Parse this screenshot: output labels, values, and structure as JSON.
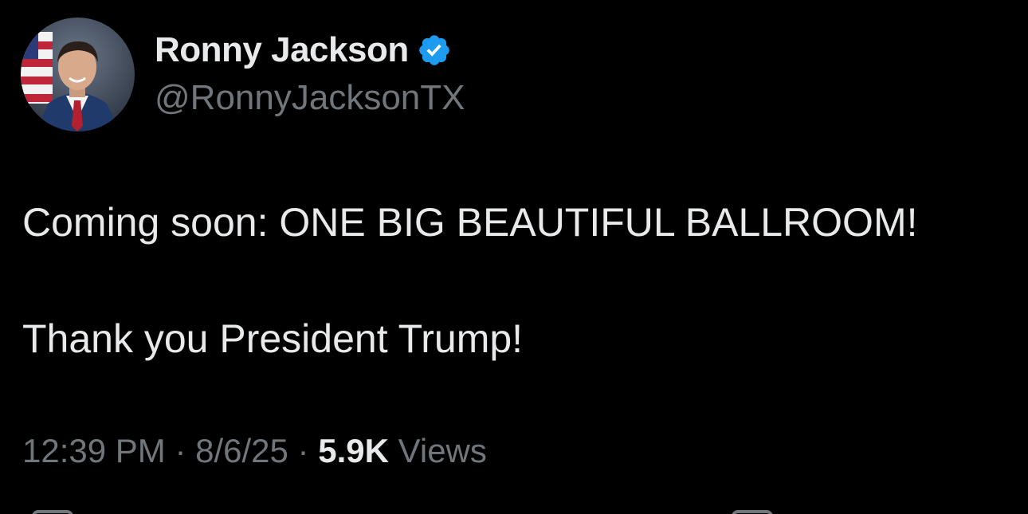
{
  "author": {
    "display_name": "Ronny Jackson",
    "handle": "@RonnyJacksonTX",
    "verified": true,
    "verified_badge_color": "#1d9bf0",
    "avatar_icon": "profile-photo"
  },
  "tweet": {
    "line1": "Coming soon: ONE BIG BEAUTIFUL BALLROOM!",
    "line2": "Thank you President Trump!"
  },
  "meta": {
    "time": "12:39 PM",
    "separator": " · ",
    "date": "8/6/25",
    "views_count": "5.9K",
    "views_label": " Views"
  },
  "colors": {
    "background": "#000000",
    "primary_text": "#e7e9ea",
    "secondary_text": "#71767b"
  },
  "actions": [
    "reply-icon",
    "bookmark-icon"
  ]
}
